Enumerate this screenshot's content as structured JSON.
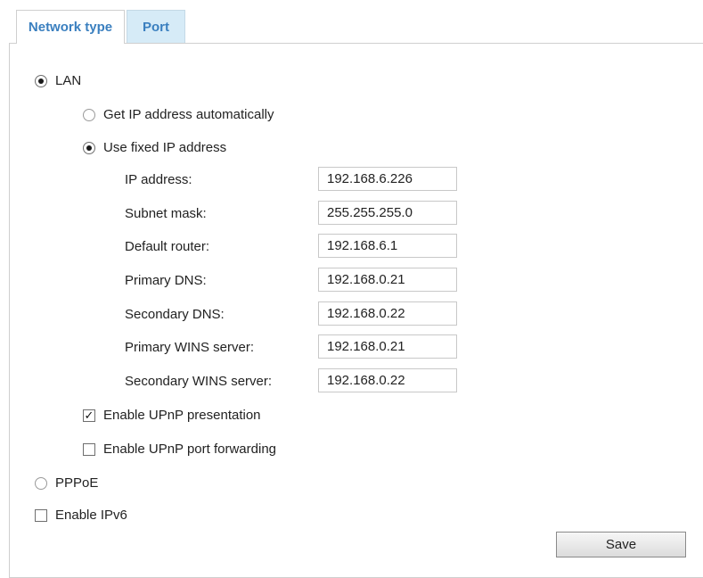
{
  "tabs": [
    {
      "label": "Network type",
      "active": true
    },
    {
      "label": "Port",
      "active": false
    }
  ],
  "lan": {
    "label": "LAN",
    "selected": true
  },
  "ip_mode": {
    "auto": {
      "label": "Get IP address automatically",
      "selected": false
    },
    "fixed": {
      "label": "Use fixed IP address",
      "selected": true
    }
  },
  "fields": [
    {
      "label": "IP address:",
      "value": "192.168.6.226"
    },
    {
      "label": "Subnet mask:",
      "value": "255.255.255.0"
    },
    {
      "label": "Default router:",
      "value": "192.168.6.1"
    },
    {
      "label": "Primary DNS:",
      "value": "192.168.0.21"
    },
    {
      "label": "Secondary DNS:",
      "value": "192.168.0.22"
    },
    {
      "label": "Primary WINS server:",
      "value": "192.168.0.21"
    },
    {
      "label": "Secondary WINS server:",
      "value": "192.168.0.22"
    }
  ],
  "upnp_presentation": {
    "label": "Enable UPnP presentation",
    "checked": true
  },
  "upnp_forwarding": {
    "label": "Enable UPnP port forwarding",
    "checked": false
  },
  "pppoe": {
    "label": "PPPoE",
    "selected": false
  },
  "ipv6": {
    "label": "Enable IPv6",
    "checked": false
  },
  "save_label": "Save",
  "colors": {
    "tab_text": "#3a7fbf",
    "inactive_tab_bg": "#d6ebf7"
  }
}
